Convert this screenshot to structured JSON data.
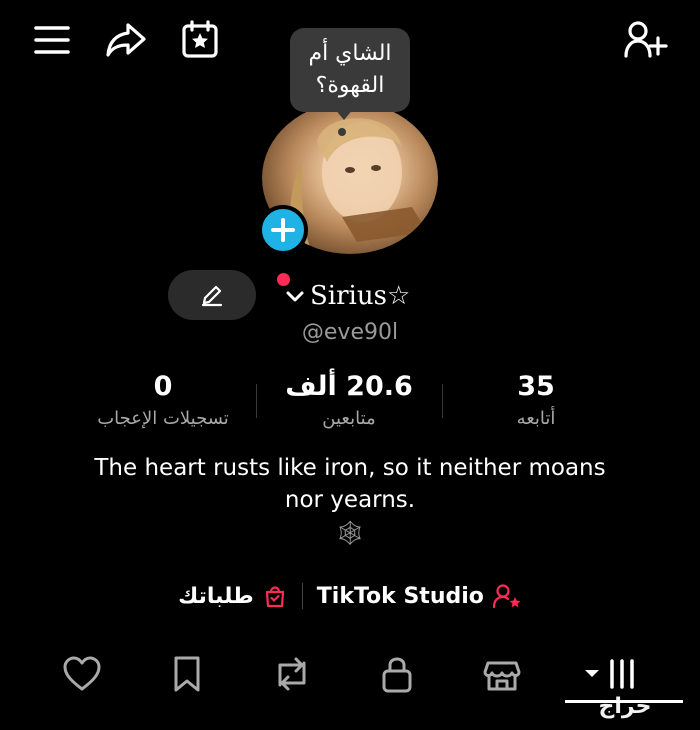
{
  "bubble": {
    "line1": "الشاي أم",
    "line2": "القهوة؟"
  },
  "profile": {
    "name": "Sirius☆",
    "handle": "@eve90l",
    "bio_line1": "The heart rusts like iron, so it neither moans",
    "bio_line2": "nor yearns.",
    "bio_emoji": "🕸"
  },
  "stats": [
    {
      "value": "0",
      "label": "تسجيلات الإعجاب"
    },
    {
      "value": "20.6 ألف",
      "label": "متابعين"
    },
    {
      "value": "35",
      "label": "أتابعه"
    }
  ],
  "links": {
    "studio": "TikTok Studio",
    "orders": "طلباتك"
  },
  "watermark": "حراج",
  "colors": {
    "accent_blue": "#1fb2e5",
    "accent_red": "#fe2c55",
    "background": "#000000"
  }
}
